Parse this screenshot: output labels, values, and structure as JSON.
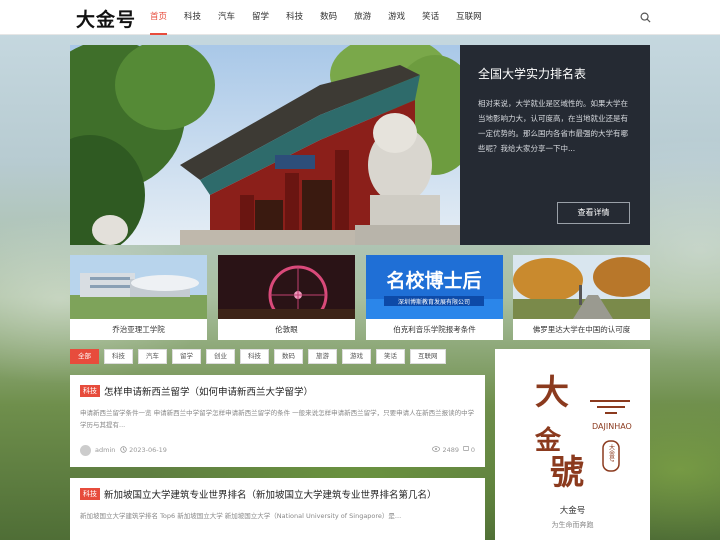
{
  "header": {
    "logo": "大金号",
    "nav": [
      "首页",
      "科技",
      "汽车",
      "留学",
      "科技",
      "数码",
      "旅游",
      "游戏",
      "笑话",
      "互联网"
    ],
    "active_index": 0
  },
  "hero": {
    "title": "全国大学实力排名表",
    "description": "相对来说，大学就业是区域性的。如果大学在当地影响力大，认可度高，在当地就业还是有一定优势的。那么国内各省市最强的大学有哪些呢？我给大家分享一下中...",
    "button": "查看详情"
  },
  "thumbs": [
    {
      "label": "乔治亚理工学院"
    },
    {
      "label": "伦敦眼"
    },
    {
      "label": "伯克利音乐学院报考条件",
      "banner": "名校博士后",
      "subbanner": "深圳博斯教育发展有限公司"
    },
    {
      "label": "佛罗里达大学在中国的认可度"
    }
  ],
  "tags": [
    "全部",
    "科技",
    "汽车",
    "留学",
    "创业",
    "科技",
    "数码",
    "旅游",
    "游戏",
    "笑话",
    "互联网"
  ],
  "articles": [
    {
      "badge": "科技",
      "title": "怎样申请新西兰留学（如何申请新西兰大学留学）",
      "excerpt": "申请新西兰留学条件一览 申请新西兰中学留学怎样申请新西兰留学的条件 一般来说怎样申请新西兰留学，只要申请人在新西兰报读的中学学历与其提有...",
      "author": "admin",
      "date": "2023-06-19",
      "views": "2489",
      "comments": "0"
    },
    {
      "badge": "科技",
      "title": "新加坡国立大学建筑专业世界排名（新加坡国立大学建筑专业世界排名第几名）",
      "excerpt": "新加坡国立大学建筑学排名 Top6 新加坡国立大学 新加坡国立大学（National University of Singapore）是..."
    }
  ],
  "sidebar": {
    "name": "大金号",
    "slogan": "为生命而奔跑",
    "logo_text_cn": "大金號",
    "logo_text_en": "DAJINHAO",
    "logo_seal": "大金号"
  },
  "colors": {
    "accent": "#e74c3c",
    "hero_panel": "#252a33",
    "logo_brown": "#8b3a1e"
  }
}
